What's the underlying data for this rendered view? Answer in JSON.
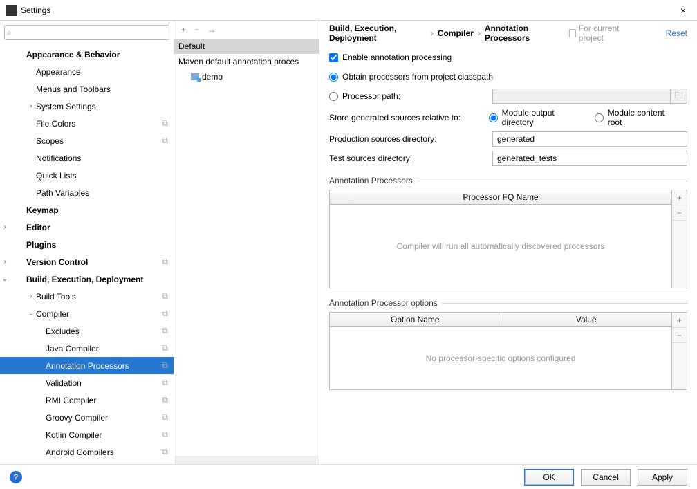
{
  "window": {
    "title": "Settings",
    "close": "×"
  },
  "search": {
    "placeholder": ""
  },
  "sidebar": [
    {
      "label": "Appearance & Behavior",
      "bold": true,
      "depth": 0,
      "arrow": ""
    },
    {
      "label": "Appearance",
      "depth": 1
    },
    {
      "label": "Menus and Toolbars",
      "depth": 1
    },
    {
      "label": "System Settings",
      "depth": 1,
      "arrow": "›"
    },
    {
      "label": "File Colors",
      "depth": 1,
      "proj": true
    },
    {
      "label": "Scopes",
      "depth": 1,
      "proj": true
    },
    {
      "label": "Notifications",
      "depth": 1
    },
    {
      "label": "Quick Lists",
      "depth": 1
    },
    {
      "label": "Path Variables",
      "depth": 1
    },
    {
      "label": "Keymap",
      "bold": true,
      "depth": 0
    },
    {
      "label": "Editor",
      "bold": true,
      "depth": 0,
      "arrow": "›",
      "outarrow": true
    },
    {
      "label": "Plugins",
      "bold": true,
      "depth": 0
    },
    {
      "label": "Version Control",
      "bold": true,
      "depth": 0,
      "arrow": "›",
      "outarrow": true,
      "proj": true
    },
    {
      "label": "Build, Execution, Deployment",
      "bold": true,
      "depth": 0,
      "arrow": "⌄",
      "outarrow": true
    },
    {
      "label": "Build Tools",
      "depth": 1,
      "arrow": "›",
      "proj": true
    },
    {
      "label": "Compiler",
      "depth": 1,
      "arrow": "⌄",
      "proj": true
    },
    {
      "label": "Excludes",
      "depth": 2,
      "proj": true
    },
    {
      "label": "Java Compiler",
      "depth": 2,
      "proj": true
    },
    {
      "label": "Annotation Processors",
      "depth": 2,
      "proj": true,
      "selected": true
    },
    {
      "label": "Validation",
      "depth": 2,
      "proj": true
    },
    {
      "label": "RMI Compiler",
      "depth": 2,
      "proj": true
    },
    {
      "label": "Groovy Compiler",
      "depth": 2,
      "proj": true
    },
    {
      "label": "Kotlin Compiler",
      "depth": 2,
      "proj": true
    },
    {
      "label": "Android Compilers",
      "depth": 2,
      "proj": true
    }
  ],
  "mid": {
    "add": "+",
    "remove": "−",
    "copy": "→",
    "items": [
      {
        "label": "Default",
        "sel": true
      },
      {
        "label": "Maven default annotation proces"
      }
    ],
    "module": "demo"
  },
  "breadcrumb": {
    "a": "Build, Execution, Deployment",
    "b": "Compiler",
    "c": "Annotation Processors",
    "sep": "›",
    "badge": "For current project",
    "reset": "Reset"
  },
  "form": {
    "enable": "Enable annotation processing",
    "obtain": "Obtain processors from project classpath",
    "ppath": "Processor path:",
    "store_label": "Store generated sources relative to:",
    "store_a": "Module output directory",
    "store_b": "Module content root",
    "prod_label": "Production sources directory:",
    "prod_value": "generated",
    "test_label": "Test sources directory:",
    "test_value": "generated_tests",
    "ann_group": "Annotation Processors",
    "ann_col": "Processor FQ Name",
    "ann_empty": "Compiler will run all automatically discovered processors",
    "opt_group": "Annotation Processor options",
    "opt_col1": "Option Name",
    "opt_col2": "Value",
    "opt_empty": "No processor-specific options configured",
    "plus": "+",
    "minus": "−"
  },
  "bottom": {
    "help": "?",
    "ok": "OK",
    "cancel": "Cancel",
    "apply": "Apply"
  }
}
